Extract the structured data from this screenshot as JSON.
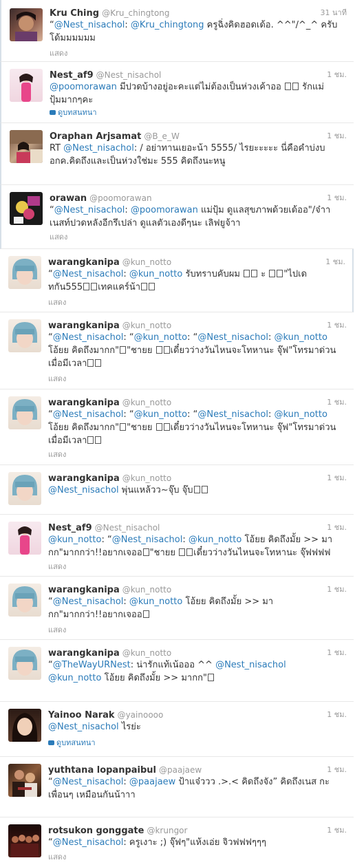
{
  "show_label": "แสดง",
  "view_conversation_label": "ดูบทสนทนา",
  "tweets": [
    {
      "name": "Kru Ching",
      "handle": "@Kru_chingtong",
      "time": "31 นาที",
      "text": [
        "“",
        "@Nest_nisachol",
        ": ",
        "@Kru_chingtong",
        " ครูฉิ่งคิดฮอดเด้อ. ^^\"/^_^ ครับ",
        "โด้มมมมมม"
      ]
    },
    {
      "name": "Nest_af9",
      "handle": "@Nest_nisachol",
      "time": "1 ชม.",
      "text": [
        "@poomorawan",
        " มีปวดบ้างอยู่อะคะแต่ไม่ต้องเป็นห่วงเค้าออ ",
        " รักแม่",
        "ปุ้มมากๆคะ"
      ]
    },
    {
      "name": "Oraphan Arjsamat",
      "handle": "@B_e_W",
      "time": "1 ชม.",
      "text": [
        "RT ",
        "@Nest_nisachol",
        ": / อย่าทานเยอะน้า 5555/ ไรยะะะะะ นี่คือคำบ่งบ",
        "อกค.คิดถึงและเป็นห่วงใช่มะ 555 คิดถึงนะหนู"
      ]
    },
    {
      "name": "orawan",
      "handle": "@poomorawan",
      "time": "1 ชม.",
      "text": [
        "“",
        "@Nest_nisachol",
        ": ",
        "@poomorawan",
        " แม่ปุ้ม ดูแลสุขภาพด้วยเด้ออ\"/จ๋าา",
        "เนสท์ปวดหลังอีกรึเปล่า ดูแลตัวเองดีๆนะ เลิฟยูจ้าา"
      ]
    },
    {
      "name": "warangkanipa",
      "handle": "@kun_notto",
      "time": "1 ชม.",
      "text": [
        "“",
        "@Nest_nisachol",
        ": ",
        "@kun_notto",
        " รับทราบคับผม ",
        " ะ ",
        "\"ไปเด",
        "ทกัน555",
        "เทคแคร์น้า"
      ]
    },
    {
      "name": "warangkanipa",
      "handle": "@kun_notto",
      "time": "1 ชม.",
      "text": [
        "“",
        "@Nest_nisachol",
        ": “",
        "@kun_notto",
        ": “",
        "@Nest_nisachol",
        ": ",
        "@kun_notto",
        "โอ้ยย คิดถึงมากก\"",
        "\"ชายย ",
        "เดี๋ยวว่างวันไหนจะโทหานะ จุ๊ฟ\"โทรมาด่วน",
        "เมื่อมีเวลา"
      ]
    },
    {
      "name": "warangkanipa",
      "handle": "@kun_notto",
      "time": "1 ชม.",
      "text": [
        "“",
        "@Nest_nisachol",
        ": “",
        "@kun_notto",
        ": “",
        "@Nest_nisachol",
        ": ",
        "@kun_notto",
        "โอ้ยย คิดถึงมากก\"",
        "\"ชายย ",
        "เดี๋ยวว่างวันไหนจะโทหานะ จุ๊ฟ\"โทรมาด่วน",
        "เมื่อมีเวลา"
      ]
    },
    {
      "name": "warangkanipa",
      "handle": "@kun_notto",
      "time": "1 ชม.",
      "text": [
        "@Nest_nisachol",
        " พุ่นแหล้วว~จุ๊บ จุ๊บ"
      ]
    },
    {
      "name": "Nest_af9",
      "handle": "@Nest_nisachol",
      "time": "1 ชม.",
      "text": [
        "@kun_notto",
        ": “",
        "@Nest_nisachol",
        ": ",
        "@kun_notto",
        " โอ้ยย คิดถึงมั้ย >> มา",
        "กก\"มากกว่า!!อยากเจออ",
        "\"ชายย ",
        "เดี๋ยวว่างวันไหนจะโทหานะ จุ๊ฟฟฟฟ"
      ]
    },
    {
      "name": "warangkanipa",
      "handle": "@kun_notto",
      "time": "1 ชม.",
      "text": [
        "“",
        "@Nest_nisachol",
        ": ",
        "@kun_notto",
        " โอ้ยย คิดถึงมั้ย >> มา",
        "กก\"มากกว่า!!อยากเจออ"
      ]
    },
    {
      "name": "warangkanipa",
      "handle": "@kun_notto",
      "time": "1 ชม.",
      "text": [
        "“",
        "@TheWayURNest",
        ": น่ารักแท้เน้อออ ^^ ",
        "@Nest_nisachol",
        "@kun_notto",
        " โอ้ยย คิดถึงมั้ย >> มากก\""
      ]
    },
    {
      "name": "Yainoo Narak",
      "handle": "@yainoooo",
      "time": "1 ชม.",
      "text": [
        "@Nest_nisachol",
        " ไรย่ะ"
      ]
    },
    {
      "name": "yuthtana lopanpaibul",
      "handle": "@paajaew",
      "time": "1 ชม.",
      "text": [
        "“",
        "@Nest_nisachol",
        ": ",
        "@paajaew",
        " ป้าแจ๋ววว .>.< คิดถึงจัง” คิดถึงเนส กะ",
        "เพื่อนๆ เหมือนกันน้าาา"
      ]
    },
    {
      "name": "rotsukon gonggate",
      "handle": "@krungor",
      "time": "1 ชม.",
      "text": [
        "“",
        "@Nest_nisachol",
        ": ครูเงาะ ;) จุ๊ฟๆ\"แห้งเอ่ย จิวฟฟฟๆๆๆ"
      ]
    }
  ],
  "colors": {
    "link": "#2b7bb9",
    "name": "#333333",
    "meta": "#999999",
    "border": "#e8e8e8"
  }
}
